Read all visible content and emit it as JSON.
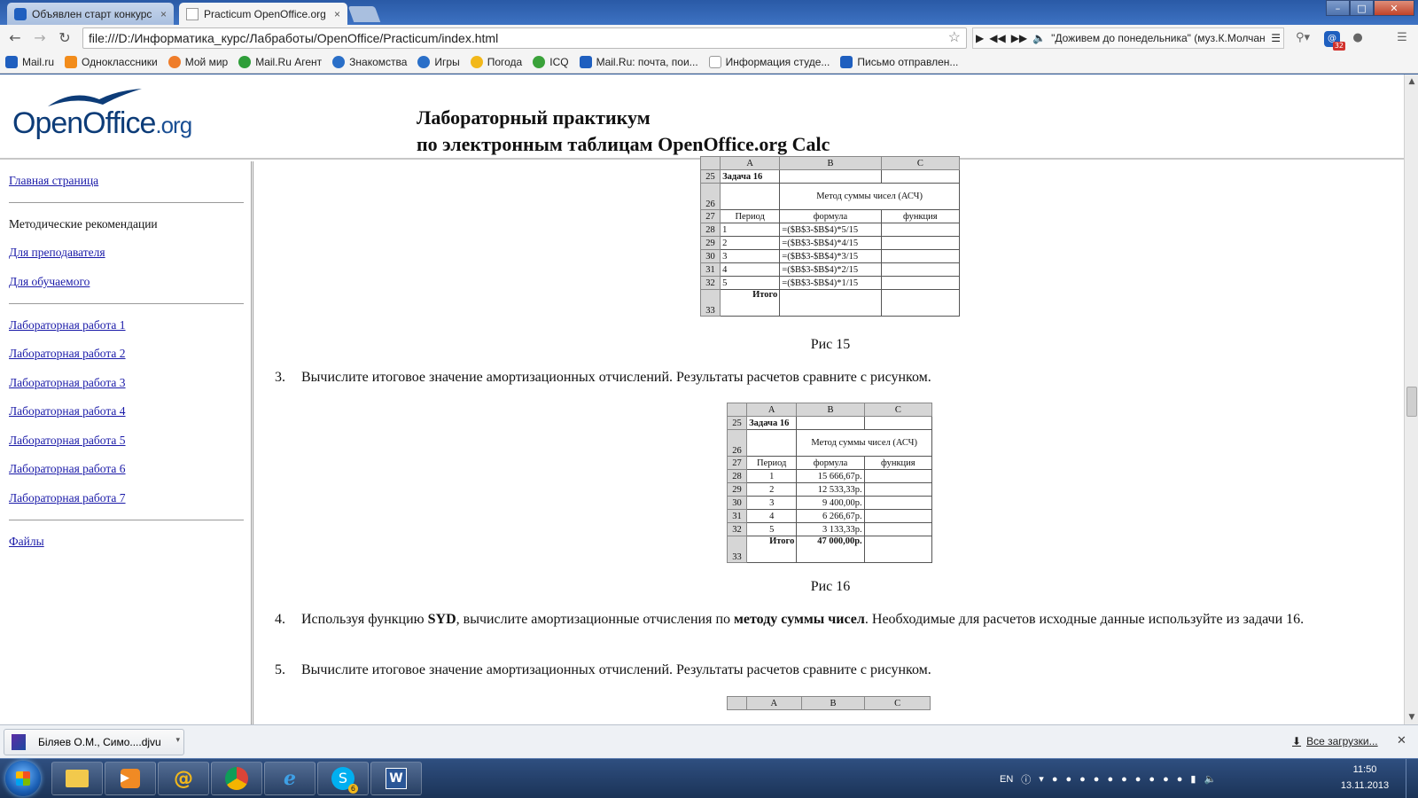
{
  "browser": {
    "tabs": [
      {
        "label": "Объявлен старт конкурс",
        "close": "×"
      },
      {
        "label": "Practicum OpenOffice.org",
        "close": "×"
      }
    ],
    "url": "file:///D:/Информатика_курс/Лабработы/OpenOffice/Practicum/index.html",
    "media_title": "\"Доживем до понедельника\" (муз.К.Молчан",
    "mail_badge": "32",
    "bookmarks": [
      {
        "label": "Mail.ru",
        "color": "#1f5fbf"
      },
      {
        "label": "Одноклассники",
        "color": "#f28c1b"
      },
      {
        "label": "Мой мир",
        "color": "#ef7d2a"
      },
      {
        "label": "Mail.Ru Агент",
        "color": "#2f9e3a"
      },
      {
        "label": "Знакомства",
        "color": "#2a6fc8"
      },
      {
        "label": "Игры",
        "color": "#2a6fc8"
      },
      {
        "label": "Погода",
        "color": "#f2b81b"
      },
      {
        "label": "ICQ",
        "color": "#3aa23a"
      },
      {
        "label": "Mail.Ru: почта, пои...",
        "color": "#1f5fbf"
      },
      {
        "label": "Информация студе...",
        "color": "#ffffff"
      },
      {
        "label": "Письмо отправлен...",
        "color": "#1f5fbf"
      }
    ]
  },
  "page": {
    "logo": {
      "main": "OpenOffice",
      "suffix": ".org"
    },
    "title_line1": "Лабораторный практикум",
    "title_line2": "по электронным таблицам OpenOffice.org Calc",
    "sidebar": {
      "home": "Главная страница",
      "methodical": "Методические рекомендации",
      "teacher": "Для преподавателя",
      "student": "Для обучаемого",
      "labs": [
        "Лабораторная работа 1",
        "Лабораторная работа 2",
        "Лабораторная работа 3",
        "Лабораторная работа 4",
        "Лабораторная работа 5",
        "Лабораторная работа 6",
        "Лабораторная работа 7"
      ],
      "files": "Файлы"
    },
    "fig15": {
      "cols": [
        "A",
        "B",
        "C"
      ],
      "task": "Задача 16",
      "method": "Метод суммы чисел (АСЧ)",
      "h_period": "Период",
      "h_formula": "формула",
      "h_function": "функция",
      "rows": [
        {
          "rn": "28",
          "a": "1",
          "b": "=($B$3-$B$4)*5/15"
        },
        {
          "rn": "29",
          "a": "2",
          "b": "=($B$3-$B$4)*4/15"
        },
        {
          "rn": "30",
          "a": "3",
          "b": "=($B$3-$B$4)*3/15"
        },
        {
          "rn": "31",
          "a": "4",
          "b": "=($B$3-$B$4)*2/15"
        },
        {
          "rn": "32",
          "a": "5",
          "b": "=($B$3-$B$4)*1/15"
        }
      ],
      "total_label": "Итого",
      "caption": "Рис 15"
    },
    "step3": {
      "num": "3.",
      "text": "Вычислите итоговое значение амортизационных отчислений. Результаты расчетов сравните с рисунком."
    },
    "fig16": {
      "cols": [
        "A",
        "B",
        "C"
      ],
      "task": "Задача 16",
      "method": "Метод суммы чисел (АСЧ)",
      "h_period": "Период",
      "h_formula": "формула",
      "h_function": "функция",
      "rows": [
        {
          "rn": "28",
          "a": "1",
          "b": "15 666,67р."
        },
        {
          "rn": "29",
          "a": "2",
          "b": "12 533,33р."
        },
        {
          "rn": "30",
          "a": "3",
          "b": "9 400,00р."
        },
        {
          "rn": "31",
          "a": "4",
          "b": "6 266,67р."
        },
        {
          "rn": "32",
          "a": "5",
          "b": "3 133,33р."
        }
      ],
      "total_label": "Итого",
      "total_value": "47 000,00р.",
      "caption": "Рис 16"
    },
    "step4": {
      "num": "4.",
      "p1": "Используя функцию ",
      "b1": "SYD",
      "p2": ", вычислите амортизационные отчисления по ",
      "b2": "методу суммы чисел",
      "p3": ". Необходимые для расчетов исходные данные используйте из задачи 16."
    },
    "step5": {
      "num": "5.",
      "text": "Вычислите итоговое значение амортизационных отчислений. Результаты расчетов сравните с рисунком."
    },
    "fig17_cols": [
      "A",
      "B",
      "C"
    ]
  },
  "downloads": {
    "file": "Біляев О.М., Симо....djvu",
    "all": "Все загрузки..."
  },
  "taskbar": {
    "lang": "EN",
    "time": "11:50",
    "date": "13.11.2013",
    "skype_badge": "6"
  }
}
